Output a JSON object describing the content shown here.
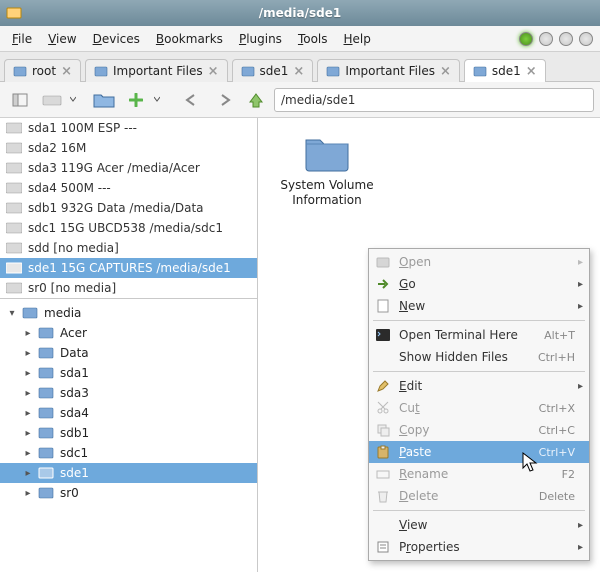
{
  "window": {
    "title": "/media/sde1"
  },
  "menubar": {
    "items": [
      {
        "label": "File",
        "accel": "F"
      },
      {
        "label": "View",
        "accel": "V"
      },
      {
        "label": "Devices",
        "accel": "D"
      },
      {
        "label": "Bookmarks",
        "accel": "B"
      },
      {
        "label": "Plugins",
        "accel": "P"
      },
      {
        "label": "Tools",
        "accel": "T"
      },
      {
        "label": "Help",
        "accel": "H"
      }
    ]
  },
  "tabs": [
    {
      "label": "root",
      "active": false
    },
    {
      "label": "Important Files",
      "active": false
    },
    {
      "label": "sde1",
      "active": false
    },
    {
      "label": "Important Files",
      "active": false
    },
    {
      "label": "sde1",
      "active": true
    }
  ],
  "path": {
    "value": "/media/sde1"
  },
  "devices": [
    {
      "label": "sda1 100M ESP ---"
    },
    {
      "label": "sda2 16M"
    },
    {
      "label": "sda3 119G Acer /media/Acer"
    },
    {
      "label": "sda4 500M ---"
    },
    {
      "label": "sdb1 932G Data /media/Data"
    },
    {
      "label": "sdc1 15G UBCD538 /media/sdc1"
    },
    {
      "label": "sdd [no media]"
    },
    {
      "label": "sde1 15G CAPTURES /media/sde1",
      "selected": true
    },
    {
      "label": "sr0 [no media]"
    }
  ],
  "tree": {
    "root": "media",
    "children": [
      {
        "name": "Acer"
      },
      {
        "name": "Data"
      },
      {
        "name": "sda1"
      },
      {
        "name": "sda3"
      },
      {
        "name": "sda4"
      },
      {
        "name": "sdb1"
      },
      {
        "name": "sdc1"
      },
      {
        "name": "sde1",
        "selected": true
      },
      {
        "name": "sr0"
      }
    ]
  },
  "iconview": {
    "items": [
      {
        "label": "System Volume Information"
      }
    ]
  },
  "context_menu": {
    "items": [
      {
        "type": "item",
        "label": "Open",
        "disabled": true,
        "submenu": true,
        "icon": "folder-open"
      },
      {
        "type": "item",
        "label": "Go",
        "submenu": true,
        "icon": "go-arrow"
      },
      {
        "type": "item",
        "label": "New",
        "submenu": true,
        "icon": "doc"
      },
      {
        "type": "sep"
      },
      {
        "type": "item",
        "label": "Open Terminal Here",
        "accel": "Alt+T",
        "icon": "terminal"
      },
      {
        "type": "item",
        "label": "Show Hidden Files",
        "accel": "Ctrl+H"
      },
      {
        "type": "sep"
      },
      {
        "type": "item",
        "label": "Edit",
        "submenu": true,
        "icon": "pencil"
      },
      {
        "type": "item",
        "label": "Cut",
        "accel": "Ctrl+X",
        "disabled": true,
        "icon": "scissors"
      },
      {
        "type": "item",
        "label": "Copy",
        "accel": "Ctrl+C",
        "disabled": true,
        "icon": "copy"
      },
      {
        "type": "item",
        "label": "Paste",
        "accel": "Ctrl+V",
        "highlight": true,
        "icon": "paste"
      },
      {
        "type": "item",
        "label": "Rename",
        "accel": "F2",
        "disabled": true,
        "icon": "rename"
      },
      {
        "type": "item",
        "label": "Delete",
        "accel": "Delete",
        "disabled": true,
        "icon": "trash"
      },
      {
        "type": "sep"
      },
      {
        "type": "item",
        "label": "View",
        "submenu": true
      },
      {
        "type": "item",
        "label": "Properties",
        "submenu": true,
        "icon": "props"
      }
    ]
  }
}
